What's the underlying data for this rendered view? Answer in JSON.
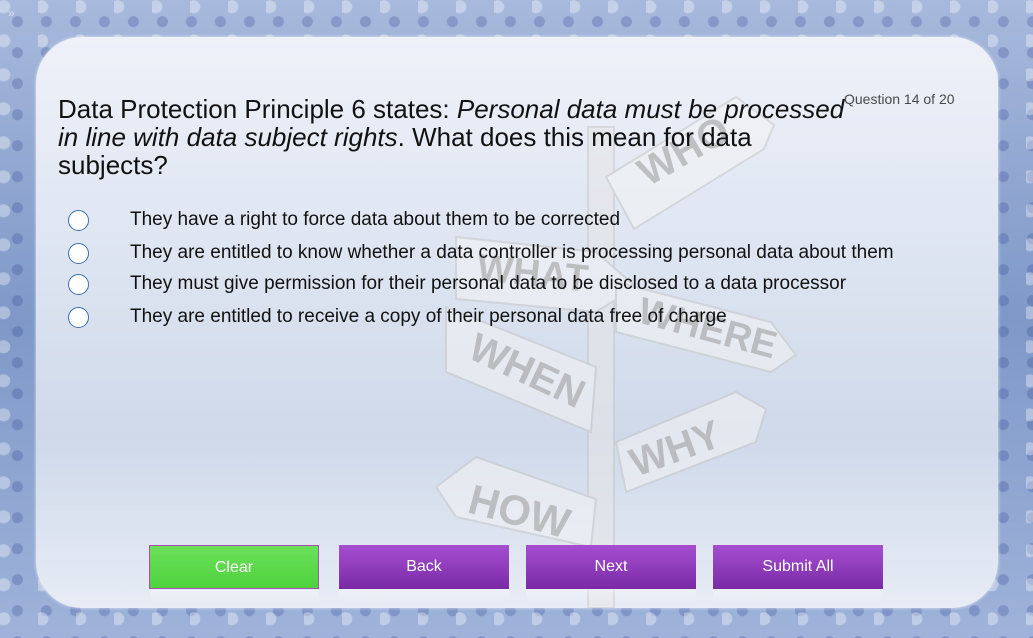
{
  "sidebar": {
    "expand_glyph": "»"
  },
  "quiz": {
    "counter": "Question 14 of 20",
    "question_prefix": "Data Protection Principle 6 states: ",
    "question_emphasis": "Personal data must be processed in line with data subject rights",
    "question_suffix": ". What does this mean for data subjects?",
    "options": [
      "They have a right to force data about them to be corrected",
      "They are entitled to know whether a data controller is processing personal data about them",
      "They must give permission for their personal data to be disclosed to a data processor",
      "They are entitled to receive a copy of their personal data free of charge"
    ]
  },
  "buttons": {
    "clear": "Clear",
    "back": "Back",
    "next": "Next",
    "submit_all": "Submit All"
  },
  "background": {
    "signpost_words": [
      "WHO",
      "WHAT",
      "WHERE",
      "WHEN",
      "WHY",
      "HOW"
    ]
  },
  "colors": {
    "clear_button": "#56d444",
    "nav_button": "#8b39b8",
    "radio_border": "#3f6fae"
  }
}
